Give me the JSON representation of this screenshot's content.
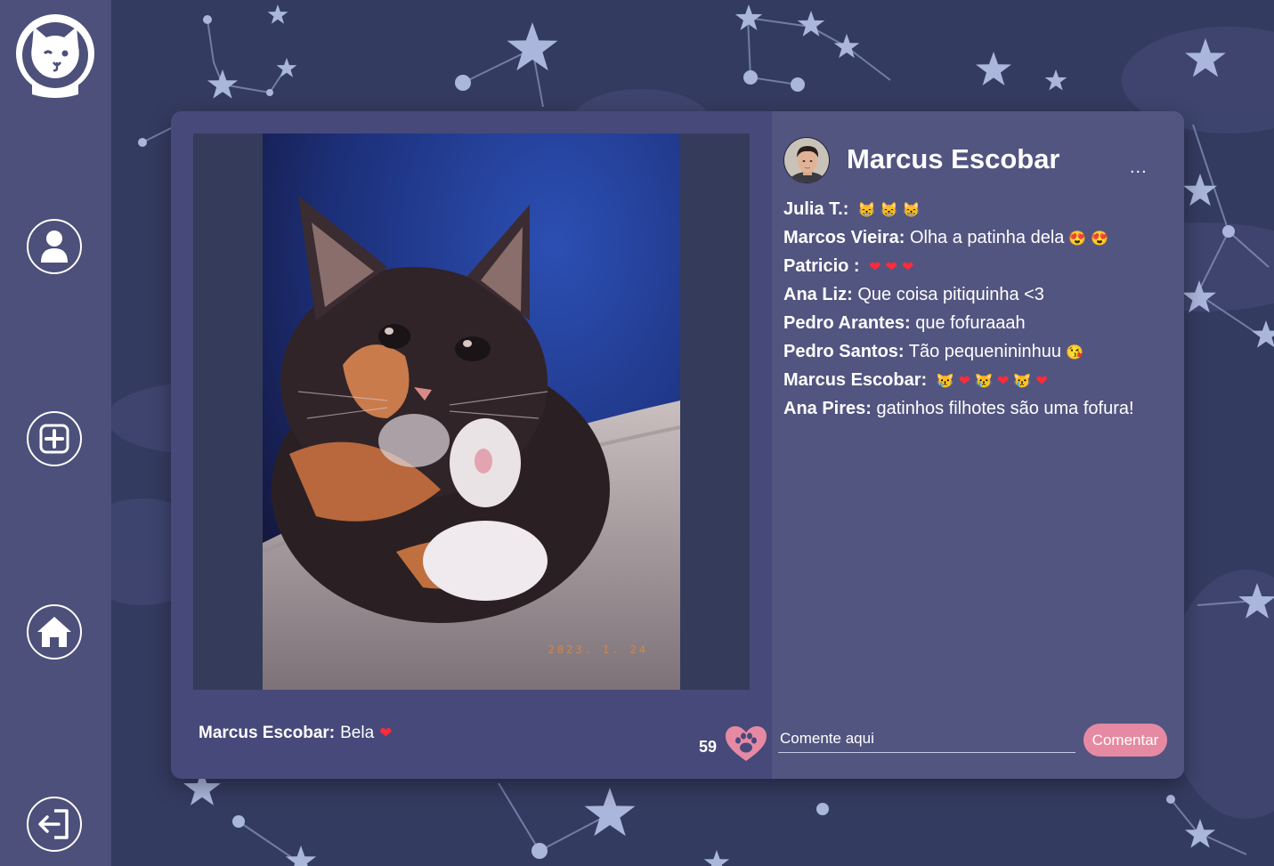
{
  "sidebar": {
    "logo_icon": "astronaut-cat-logo",
    "items": [
      {
        "name": "profile",
        "icon": "user-icon"
      },
      {
        "name": "new-post",
        "icon": "plus-square-icon"
      },
      {
        "name": "home",
        "icon": "home-icon"
      },
      {
        "name": "logout",
        "icon": "logout-icon"
      }
    ]
  },
  "post": {
    "author": "Marcus Escobar",
    "more_label": "...",
    "photo_date": "2023. 1. 24",
    "caption": {
      "author": "Marcus Escobar:",
      "text": "Bela",
      "emoji": "❤"
    },
    "likes": "59"
  },
  "comments": [
    {
      "author": "Julia T.:",
      "text": "",
      "emojis": [
        [
          "cat",
          "😸"
        ],
        [
          "cat",
          "😸"
        ],
        [
          "cat",
          "😸"
        ]
      ]
    },
    {
      "author": "Marcos Vieira:",
      "text": "Olha a patinha dela",
      "emojis": [
        [
          "face",
          "😍"
        ],
        [
          "face",
          "😍"
        ]
      ]
    },
    {
      "author": "Patricio :",
      "text": "",
      "emojis": [
        [
          "heart",
          "❤"
        ],
        [
          "heart",
          "❤"
        ],
        [
          "heart",
          "❤"
        ]
      ]
    },
    {
      "author": "Ana Liz:",
      "text": "Que coisa pitiquinha <3",
      "emojis": []
    },
    {
      "author": "Pedro Arantes:",
      "text": "que fofuraaah",
      "emojis": []
    },
    {
      "author": "Pedro Santos:",
      "text": "Tão pequenininhuu",
      "emojis": [
        [
          "face",
          "😘"
        ]
      ]
    },
    {
      "author": "Marcus Escobar:",
      "text": "",
      "emojis": [
        [
          "cat",
          "😿"
        ],
        [
          "heart",
          "❤"
        ],
        [
          "cat",
          "😿"
        ],
        [
          "heart",
          "❤"
        ],
        [
          "cat",
          "😿"
        ],
        [
          "heart",
          "❤"
        ]
      ]
    },
    {
      "author": "Ana Pires:",
      "text": "gatinhos filhotes são uma fofura!",
      "emojis": []
    }
  ],
  "comment_form": {
    "placeholder": "Comente aqui",
    "button_label": "Comentar"
  },
  "colors": {
    "background": "#333a5e",
    "sidebar": "#4c507a",
    "card": "#47497a",
    "comment_button": "#e68aa3",
    "like_heart": "#e68aa3"
  }
}
